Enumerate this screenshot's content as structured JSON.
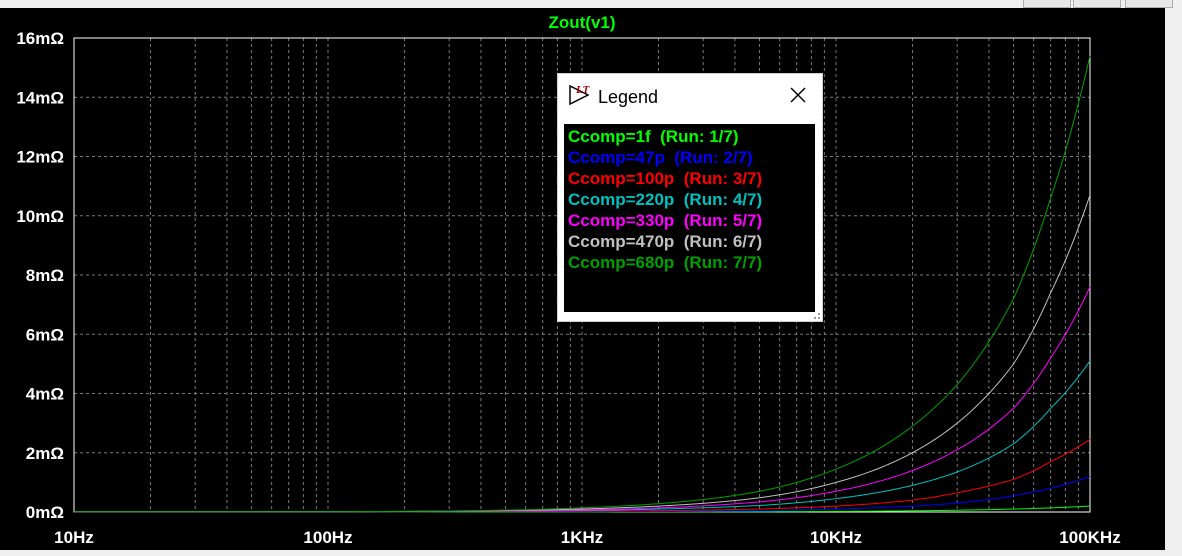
{
  "chart_data": {
    "type": "line",
    "title": "Zout(v1)",
    "xscale": "log",
    "xlim": [
      10,
      100000
    ],
    "ylim": [
      0,
      16
    ],
    "x_ticks": [
      "10Hz",
      "100Hz",
      "1KHz",
      "10KHz",
      "100KHz"
    ],
    "y_ticks": [
      "0mΩ",
      "2mΩ",
      "4mΩ",
      "6mΩ",
      "8mΩ",
      "10mΩ",
      "12mΩ",
      "14mΩ",
      "16mΩ"
    ],
    "grid": true,
    "background": "#000000",
    "x": [
      10,
      100,
      1000,
      2000,
      5000,
      10000,
      20000,
      30000,
      50000,
      70000,
      100000
    ],
    "series": [
      {
        "name": "Ccomp=1f",
        "color": "#00ff00",
        "values": [
          0.001,
          0.001,
          0.002,
          0.004,
          0.009,
          0.02,
          0.04,
          0.06,
          0.1,
          0.14,
          0.2
        ]
      },
      {
        "name": "Ccomp=47p",
        "color": "#0000ff",
        "values": [
          0.01,
          0.01,
          0.012,
          0.02,
          0.045,
          0.1,
          0.2,
          0.3,
          0.55,
          0.8,
          1.2
        ]
      },
      {
        "name": "Ccomp=100p",
        "color": "#ff0000",
        "values": [
          0.01,
          0.01,
          0.025,
          0.045,
          0.1,
          0.2,
          0.4,
          0.65,
          1.1,
          1.7,
          2.45
        ]
      },
      {
        "name": "Ccomp=220p",
        "color": "#00c0c0",
        "values": [
          0.01,
          0.01,
          0.05,
          0.1,
          0.22,
          0.45,
          0.9,
          1.35,
          2.3,
          3.5,
          5.1
        ]
      },
      {
        "name": "Ccomp=330p",
        "color": "#ff00ff",
        "values": [
          0.01,
          0.01,
          0.07,
          0.14,
          0.34,
          0.7,
          1.4,
          2.1,
          3.5,
          5.2,
          7.6
        ]
      },
      {
        "name": "Ccomp=470p",
        "color": "#c0c0c0",
        "values": [
          0.01,
          0.01,
          0.1,
          0.2,
          0.48,
          1.0,
          2.0,
          3.0,
          5.0,
          7.4,
          10.7
        ]
      },
      {
        "name": "Ccomp=680p",
        "color": "#00a000",
        "values": [
          0.01,
          0.01,
          0.14,
          0.28,
          0.7,
          1.45,
          2.9,
          4.3,
          7.2,
          10.6,
          15.4
        ]
      }
    ]
  },
  "legend": {
    "title": "Legend",
    "entries": [
      {
        "name": "Ccomp=1f",
        "run": "(Run: 1/7)",
        "color": "#00ff00"
      },
      {
        "name": "Ccomp=47p",
        "run": "(Run: 2/7)",
        "color": "#0000ff"
      },
      {
        "name": "Ccomp=100p",
        "run": "(Run: 3/7)",
        "color": "#ff0000"
      },
      {
        "name": "Ccomp=220p",
        "run": "(Run: 4/7)",
        "color": "#00c0c0"
      },
      {
        "name": "Ccomp=330p",
        "run": "(Run: 5/7)",
        "color": "#ff00ff"
      },
      {
        "name": "Ccomp=470p",
        "run": "(Run: 6/7)",
        "color": "#c0c0c0"
      },
      {
        "name": "Ccomp=680p",
        "run": "(Run: 7/7)",
        "color": "#00a000"
      }
    ]
  }
}
